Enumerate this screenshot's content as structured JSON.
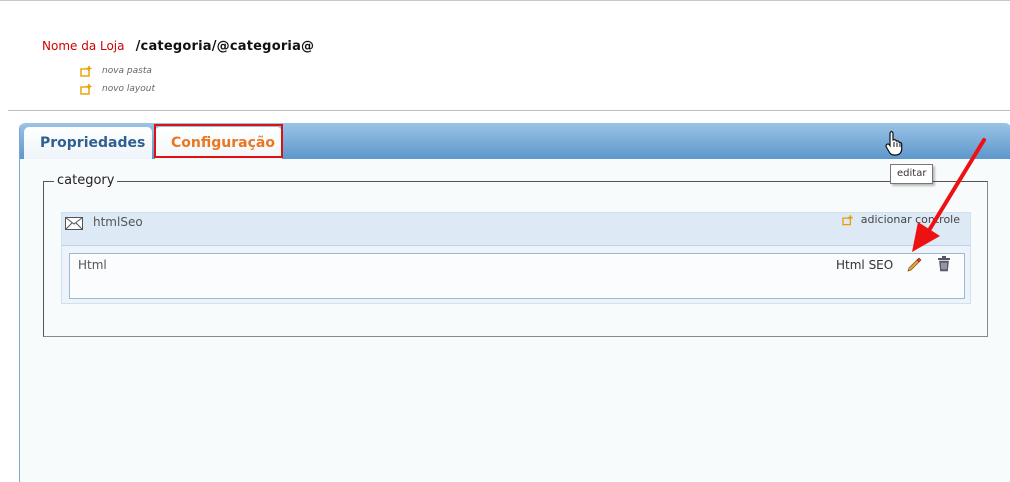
{
  "header": {
    "store_name": "Nome da Loja",
    "path": "/categoria/@categoria@",
    "actions": [
      {
        "label": "nova pasta",
        "icon": "folder-add-icon"
      },
      {
        "label": "novo layout",
        "icon": "layout-add-icon"
      }
    ]
  },
  "tabs": [
    {
      "label": "Propriedades",
      "active": true
    },
    {
      "label": "Configuração",
      "highlighted": true
    }
  ],
  "fieldset": {
    "legend": "category",
    "control": {
      "name": "htmlSeo",
      "icon": "envelope-icon",
      "add_label": "adicionar controle",
      "items": [
        {
          "type": "Html",
          "description": "Html SEO",
          "edit_tooltip": "editar"
        }
      ]
    }
  },
  "colors": {
    "store_name": "#d40000",
    "tab_active_text": "#2f5f8f",
    "tab_config_text": "#e87722",
    "highlight": "#dd1111",
    "arrow": "#ee1111",
    "tab_bar": "#5d97cc"
  }
}
